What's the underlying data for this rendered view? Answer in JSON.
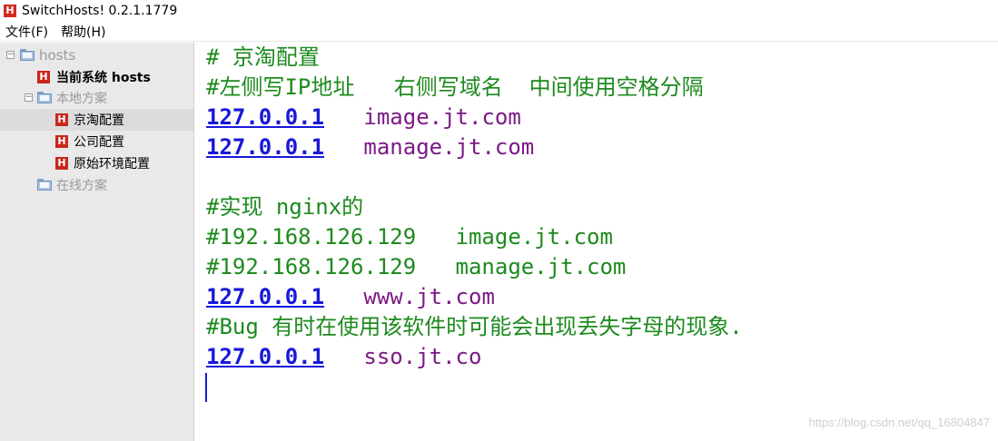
{
  "window": {
    "title": "SwitchHosts! 0.2.1.1779",
    "icon_letter": "H"
  },
  "menu": {
    "items": [
      "文件(F)",
      "帮助(H)"
    ]
  },
  "sidebar": {
    "root": {
      "label": "hosts",
      "toggle": "−"
    },
    "current_system": {
      "label": "当前系统 hosts",
      "icon_letter": "H"
    },
    "local_group": {
      "label": "本地方案",
      "toggle": "−"
    },
    "local_items": [
      {
        "label": "京淘配置",
        "icon_letter": "H",
        "selected": true
      },
      {
        "label": "公司配置",
        "icon_letter": "H",
        "selected": false
      },
      {
        "label": "原始环境配置",
        "icon_letter": "H",
        "selected": false
      }
    ],
    "online_group": {
      "label": "在线方案"
    }
  },
  "editor": {
    "lines": [
      {
        "type": "comment",
        "text": "# 京淘配置"
      },
      {
        "type": "comment",
        "text": "#左侧写IP地址   右侧写域名  中间使用空格分隔"
      },
      {
        "type": "entry",
        "ip": "127.0.0.1",
        "sep": "   ",
        "domain": "image.jt.com"
      },
      {
        "type": "entry",
        "ip": "127.0.0.1",
        "sep": "   ",
        "domain": "manage.jt.com"
      },
      {
        "type": "blank",
        "text": ""
      },
      {
        "type": "comment",
        "text": "#实现 nginx的"
      },
      {
        "type": "comment",
        "text": "#192.168.126.129   image.jt.com"
      },
      {
        "type": "comment",
        "text": "#192.168.126.129   manage.jt.com"
      },
      {
        "type": "entry",
        "ip": "127.0.0.1",
        "sep": "   ",
        "domain": "www.jt.com"
      },
      {
        "type": "comment",
        "text": "#Bug 有时在使用该软件时可能会出现丢失字母的现象."
      },
      {
        "type": "entry",
        "ip": "127.0.0.1",
        "sep": "   ",
        "domain": "sso.jt.co"
      }
    ]
  },
  "watermark": "https://blog.csdn.net/qq_16804847",
  "colors": {
    "comment": "#1d8a1d",
    "ip": "#1818d8",
    "domain": "#7b1a85",
    "brand_red": "#c8281c",
    "sidebar_bg": "#e9e9e9"
  }
}
